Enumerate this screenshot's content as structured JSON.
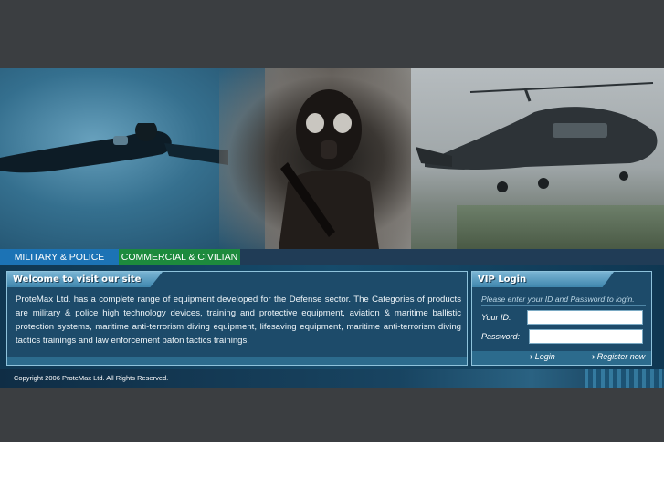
{
  "tabs": {
    "military": "MILITARY & POLICE",
    "commercial": "COMMERCIAL & CIVILIAN"
  },
  "welcome": {
    "title": "Welcome to visit our site",
    "body": "ProteMax Ltd. has a complete range of equipment developed for the Defense sector. The Categories of products are military & police high technology devices, training and protective equipment, aviation & maritime ballistic protection systems, maritime anti-terrorism diving equipment, lifesaving equipment, maritime anti-terrorism diving tactics trainings and law enforcement baton tactics trainings."
  },
  "login": {
    "title": "VIP Login",
    "hint": "Please enter your ID and Password to login.",
    "id_label": "Your ID:",
    "password_label": "Password:",
    "login_link": "Login",
    "register_link": "Register now"
  },
  "footer": {
    "copyright": "Copyright 2006 ProteMax Ltd. All Rights Reserved."
  },
  "colors": {
    "tab_military": "#1c73b5",
    "tab_commercial": "#1d8a3d",
    "panel_bg": "#1d4b6a",
    "band": "#3b3e41"
  }
}
